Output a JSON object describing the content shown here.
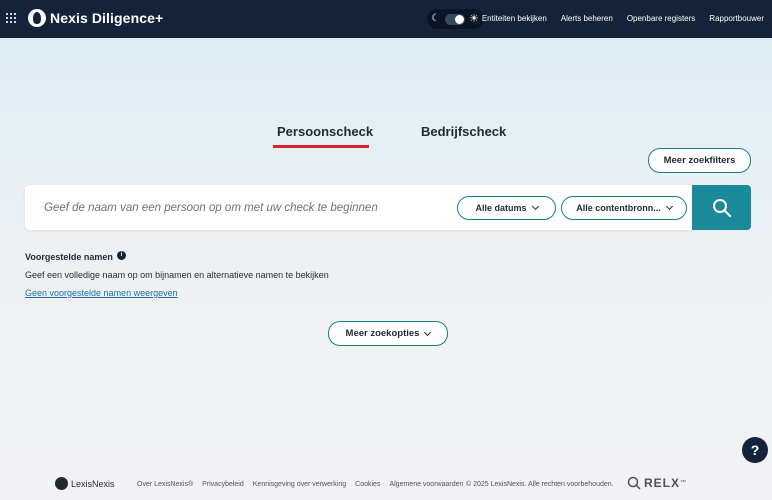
{
  "header": {
    "brand": "Nexis Diligence+",
    "nav": [
      "Entiteiten bekijken",
      "Alerts beheren",
      "Openbare registers",
      "Rapportbouwer"
    ]
  },
  "tabs": {
    "persons": "Persoonscheck",
    "company": "Bedrijfscheck",
    "active": "Persoonscheck"
  },
  "filters_button": "Meer zoekfilters",
  "search": {
    "placeholder": "Geef de naam van een persoon op om met uw check te beginnen",
    "value": "",
    "date_filter": "Alle datums",
    "source_filter": "Alle contentbronn..."
  },
  "suggestions": {
    "title": "Voorgestelde namen",
    "info": "i",
    "description": "Geef een volledige naam op om bijnamen en alternatieve namen te bekijken",
    "link": "Geen voorgestelde namen weergeven"
  },
  "more_options": "Meer zoekopties",
  "help": "?",
  "footer": {
    "logo": "LexisNexis",
    "links": [
      "Over LexisNexis®",
      "Privacybeleid",
      "Kennisgeving over verwerking",
      "Cookies",
      "Algemene voorwaarden"
    ],
    "copyright": "© 2025 LexisNexis. Alle rechten voorbehouden.",
    "relx": "RELX",
    "relx_tm": "™"
  },
  "colors": {
    "header_bg": "#13243a",
    "accent": "#1b8b9c",
    "tab_underline": "#d7262c"
  }
}
